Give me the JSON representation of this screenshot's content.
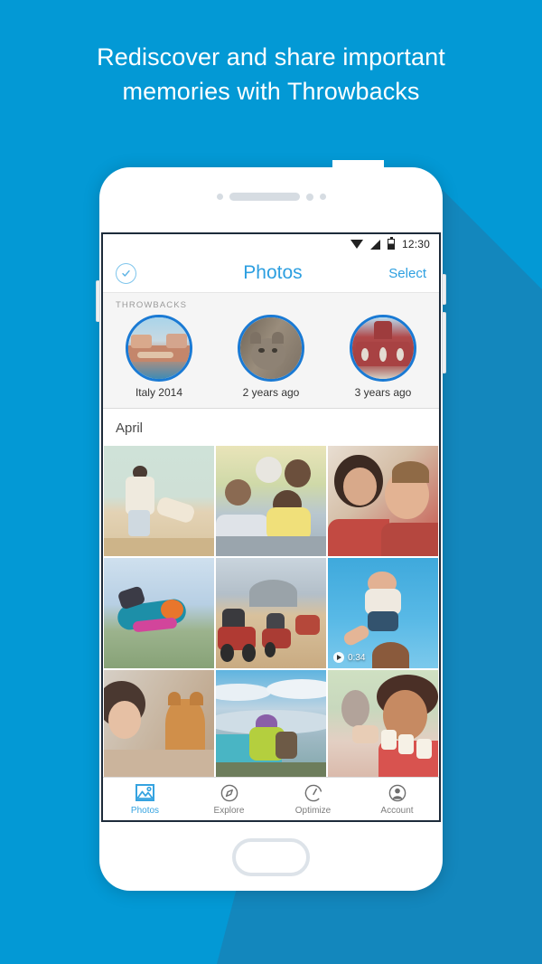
{
  "background": {
    "color": "#0399D5",
    "shadow_color": "#1387BD"
  },
  "headline": {
    "line1": "Rediscover and share important",
    "line2": "memories with Throwbacks"
  },
  "phone": {
    "statusbar": {
      "time": "12:30",
      "icons": [
        "wifi-icon",
        "signal-icon",
        "battery-icon"
      ]
    },
    "header": {
      "left_icon": "check-circle-icon",
      "title": "Photos",
      "action": "Select",
      "accent_color": "#2d9fe0"
    },
    "throwbacks": {
      "label": "THROWBACKS",
      "items": [
        {
          "caption": "Italy 2014",
          "art": "venice-canal-photo"
        },
        {
          "caption": "2 years ago",
          "art": "cat-portrait-photo"
        },
        {
          "caption": "3 years ago",
          "art": "red-brick-building-photo"
        }
      ]
    },
    "gallery": {
      "section_title": "April",
      "cells": [
        {
          "art": "father-swinging-child-beach",
          "video": null
        },
        {
          "art": "family-grandparents-kids-park",
          "video": null
        },
        {
          "art": "smiling-couple-selfie",
          "video": null
        },
        {
          "art": "skydiver-freefall",
          "video": null
        },
        {
          "art": "atv-riders-desert",
          "video": null
        },
        {
          "art": "toddler-tossed-in-air",
          "video": {
            "duration": "0:34"
          }
        },
        {
          "art": "woman-with-orange-cat",
          "video": null
        },
        {
          "art": "hiker-on-mountain-overlook",
          "video": null
        },
        {
          "art": "girl-with-marshmallows",
          "video": null
        }
      ]
    },
    "tabbar": {
      "items": [
        {
          "label": "Photos",
          "icon": "photos-icon",
          "active": true
        },
        {
          "label": "Explore",
          "icon": "compass-icon",
          "active": false
        },
        {
          "label": "Optimize",
          "icon": "gauge-icon",
          "active": false
        },
        {
          "label": "Account",
          "icon": "person-icon",
          "active": false
        }
      ]
    }
  }
}
